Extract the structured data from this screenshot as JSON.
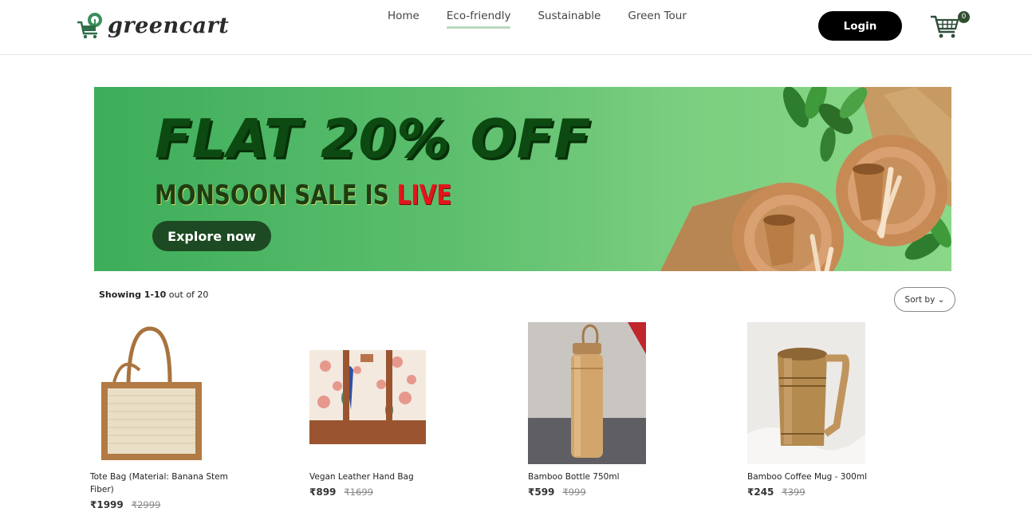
{
  "brand": {
    "name": "greencart",
    "icon": "tree-cart-logo-icon"
  },
  "nav": {
    "items": [
      {
        "label": "Home",
        "active": false
      },
      {
        "label": "Eco-friendly",
        "active": true
      },
      {
        "label": "Sustainable",
        "active": false
      },
      {
        "label": "Green Tour",
        "active": false
      }
    ]
  },
  "header": {
    "login_label": "Login",
    "cart_count": "0",
    "cart_icon": "shopping-cart-icon"
  },
  "banner": {
    "headline": "FLAT 20% OFF",
    "subline_prefix": "MONSOON SALE IS ",
    "subline_highlight": "LIVE",
    "cta_label": "Explore now"
  },
  "listing": {
    "showing_prefix": "Showing ",
    "showing_range": "1-10",
    "showing_suffix": " out of 20",
    "sort_label": "Sort by"
  },
  "products": [
    {
      "name": "Tote Bag (Material: Banana Stem Fiber)",
      "price": "₹1999",
      "old_price": "₹2999"
    },
    {
      "name": "Vegan Leather Hand Bag",
      "price": "₹899",
      "old_price": "₹1699"
    },
    {
      "name": "Bamboo Bottle 750ml",
      "price": "₹599",
      "old_price": "₹999"
    },
    {
      "name": "Bamboo Coffee Mug - 300ml",
      "price": "₹245",
      "old_price": "₹399"
    }
  ],
  "colors": {
    "accent": "#1d4a22",
    "banner_green": "#5bbe6d",
    "live_red": "#e3151b"
  }
}
